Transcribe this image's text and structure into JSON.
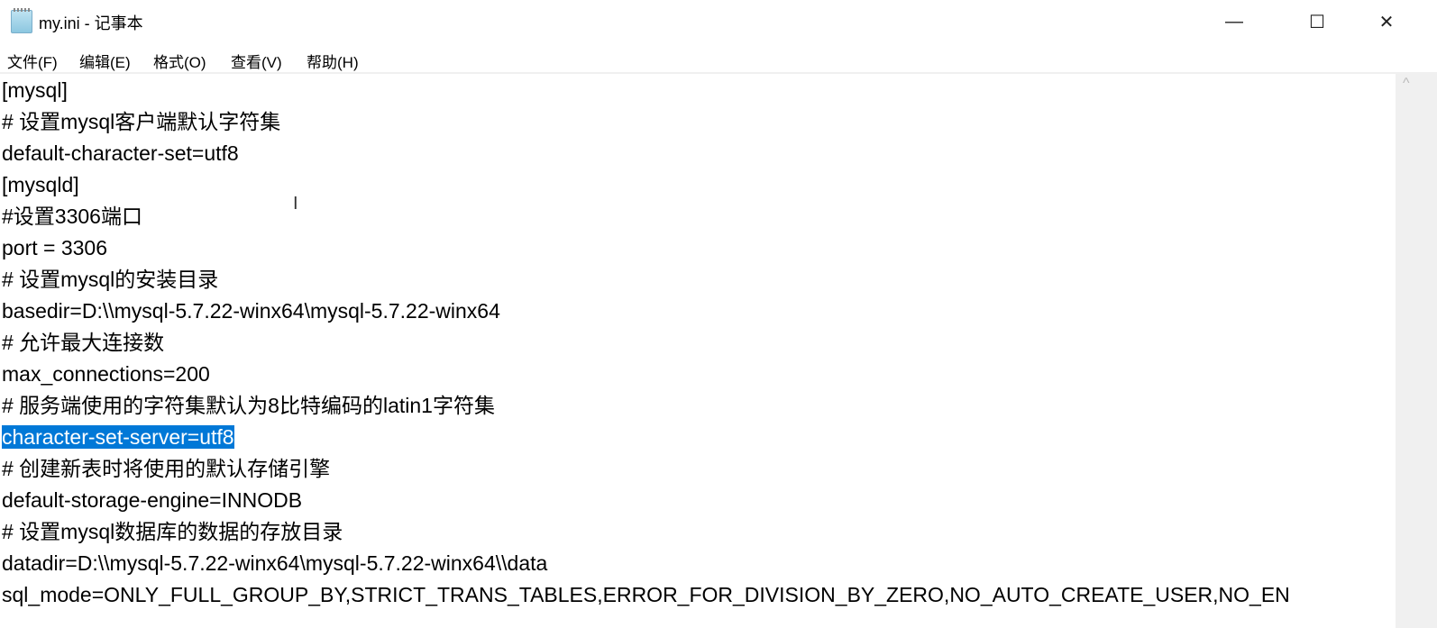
{
  "window": {
    "title": "my.ini - 记事本",
    "controls": {
      "minimize": "—",
      "maximize": "☐",
      "close": "✕"
    }
  },
  "menu": [
    "文件(F)",
    "编辑(E)",
    "格式(O)",
    "查看(V)",
    "帮助(H)"
  ],
  "editor": {
    "lines": [
      "[mysql]",
      "# 设置mysql客户端默认字符集",
      "default-character-set=utf8",
      "[mysqld]",
      "#设置3306端口",
      "port = 3306",
      "# 设置mysql的安装目录",
      "basedir=D:\\\\mysql-5.7.22-winx64\\mysql-5.7.22-winx64",
      "# 允许最大连接数",
      "max_connections=200",
      "# 服务端使用的字符集默认为8比特编码的latin1字符集",
      "character-set-server=utf8",
      "# 创建新表时将使用的默认存储引擎",
      "default-storage-engine=INNODB",
      "# 设置mysql数据库的数据的存放目录",
      "datadir=D:\\\\mysql-5.7.22-winx64\\mysql-5.7.22-winx64\\\\data",
      "sql_mode=ONLY_FULL_GROUP_BY,STRICT_TRANS_TABLES,ERROR_FOR_DIVISION_BY_ZERO,NO_AUTO_CREATE_USER,NO_EN"
    ],
    "selected_line": 11,
    "selection_color": "#0078d7"
  },
  "icons": {
    "app": "notepad-icon",
    "cursor": "text-cursor-icon",
    "scroll_up": "chevron-up-icon"
  }
}
